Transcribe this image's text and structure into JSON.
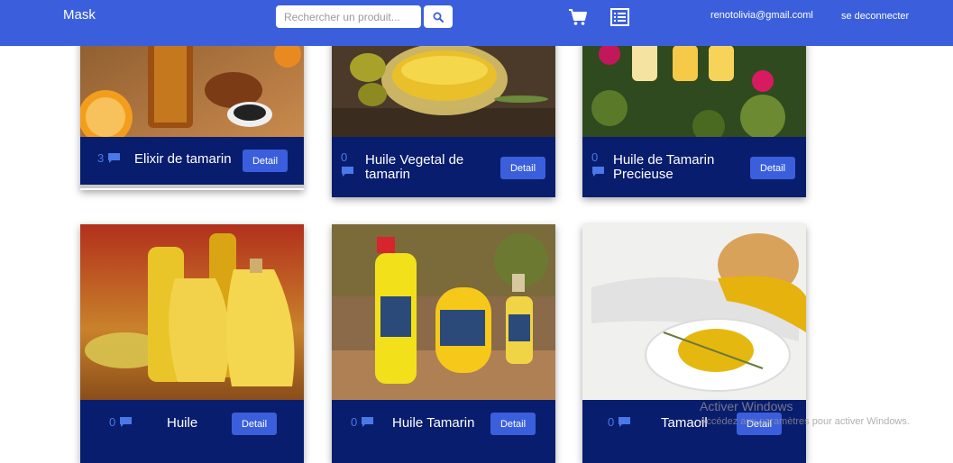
{
  "navbar": {
    "brand": "Mask",
    "search_placeholder": "Rechercher un produit...",
    "email": "renotolivia@gmail.coml",
    "logout_label": "se deconnecter",
    "icons": [
      "search-icon",
      "cart-icon",
      "list-icon"
    ],
    "bg_color": "#3b5fdc"
  },
  "products": [
    {
      "count": "3",
      "name": "Elixir de tamarin",
      "detail_label": "Detail"
    },
    {
      "count": "0",
      "name": "Huile Vegetal de tamarin",
      "detail_label": "Detail"
    },
    {
      "count": "0",
      "name": "Huile de Tamarin Precieuse",
      "detail_label": "Detail"
    },
    {
      "count": "0",
      "name": "Huile",
      "detail_label": "Detail"
    },
    {
      "count": "0",
      "name": "Huile Tamarin",
      "detail_label": "Detail"
    },
    {
      "count": "0",
      "name": "Tamaoil",
      "detail_label": "Detail"
    }
  ],
  "watermark": {
    "title": "Activer Windows",
    "subtitle": "Accédez aux paramètres pour activer Windows."
  },
  "colors": {
    "footer": "#091d6e",
    "button": "#3b5fdc",
    "count": "#4a78e6"
  }
}
